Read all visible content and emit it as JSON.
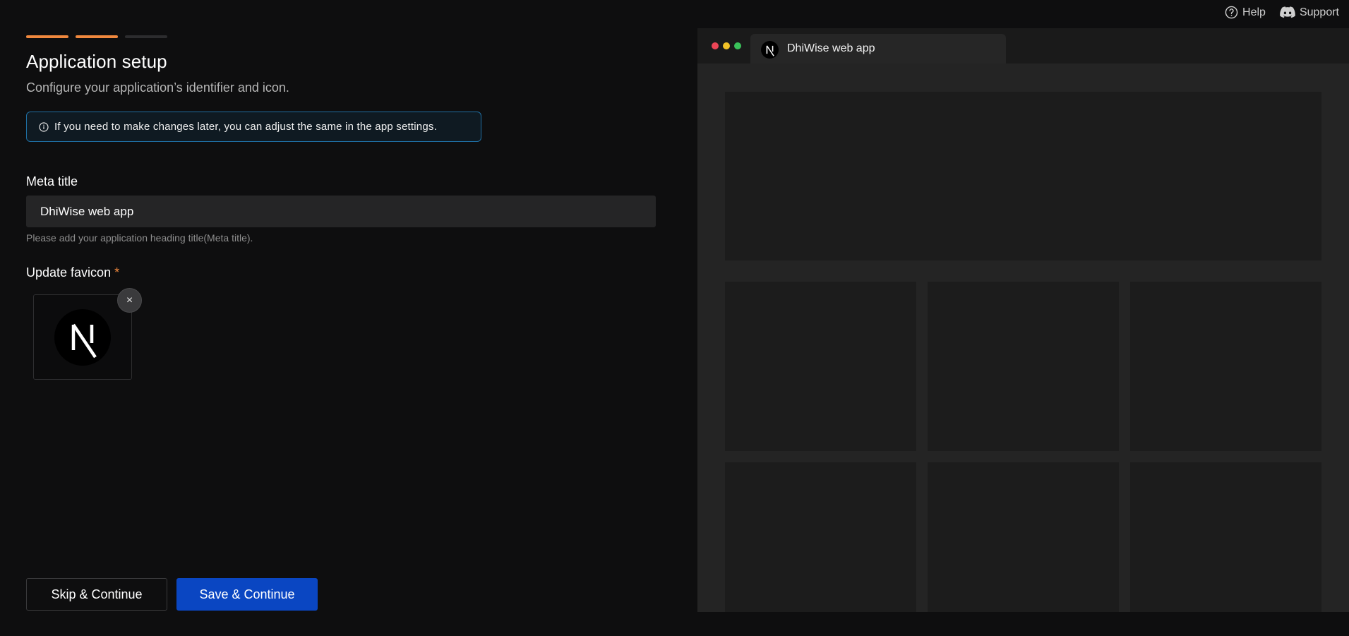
{
  "topbar": {
    "help_label": "Help",
    "support_label": "Support"
  },
  "progress": {
    "total_steps": 3,
    "completed_steps": 2,
    "active_color": "#f0883e"
  },
  "page": {
    "title": "Application setup",
    "subtitle": "Configure your application’s identifier and icon."
  },
  "info_banner": {
    "icon": "info-icon",
    "text": "If you need to make changes later, you can adjust the same in the app settings."
  },
  "meta_title": {
    "label": "Meta title",
    "value": "DhiWise web app",
    "hint": "Please add your application heading title(Meta title)."
  },
  "favicon": {
    "label": "Update favicon",
    "required_marker": "*",
    "remove_label": "×",
    "icon": "nextjs-logo-icon"
  },
  "actions": {
    "skip_label": "Skip & Continue",
    "save_label": "Save & Continue",
    "primary_color": "#0a46c2"
  },
  "preview": {
    "tab_title": "DhiWise web app",
    "window_controls": [
      "red",
      "yellow",
      "green"
    ]
  }
}
